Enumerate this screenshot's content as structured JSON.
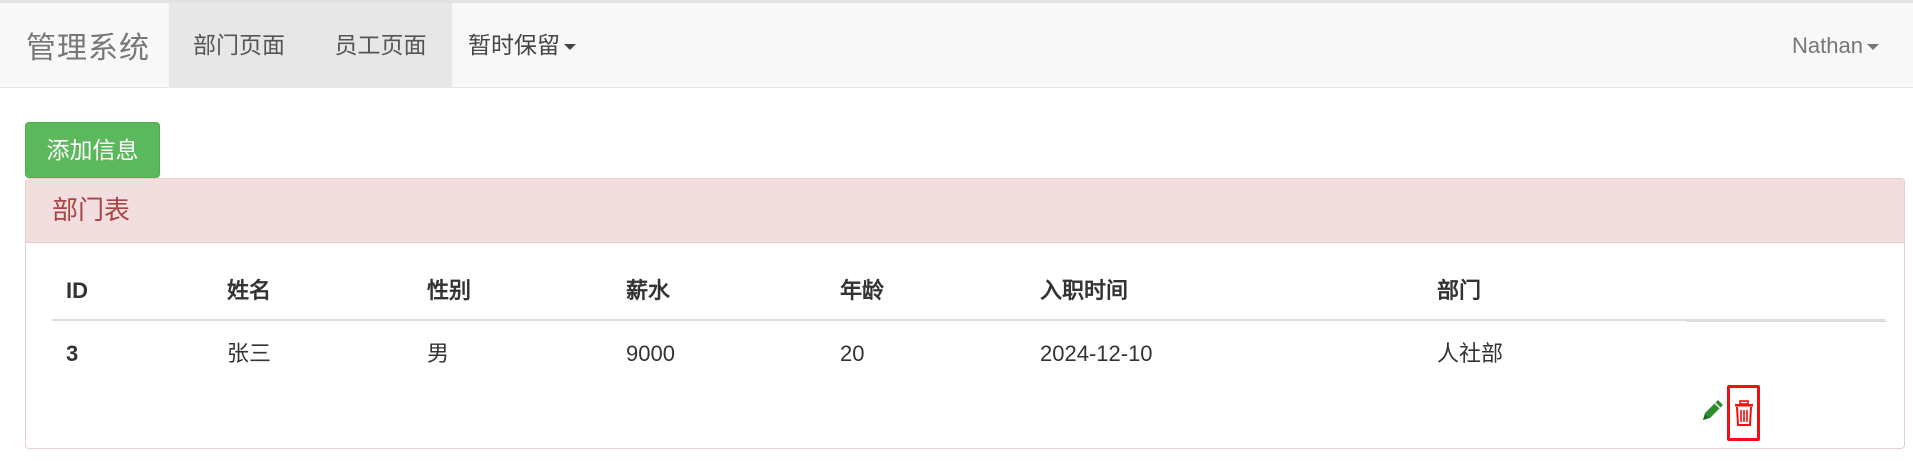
{
  "navbar": {
    "brand": "管理系统",
    "items": [
      {
        "label": "部门页面"
      },
      {
        "label": "员工页面"
      },
      {
        "label": "暂时保留"
      }
    ],
    "user": "Nathan"
  },
  "add_button": "添加信息",
  "panel": {
    "title": "部门表",
    "columns": [
      "ID",
      "姓名",
      "性别",
      "薪水",
      "年龄",
      "入职时间",
      "部门"
    ],
    "rows": [
      {
        "id": "3",
        "name": "张三",
        "gender": "男",
        "salary": "9000",
        "age": "20",
        "hire_date": "2024-12-10",
        "dept": "人社部"
      }
    ]
  },
  "colors": {
    "success": "#5cb85c",
    "danger_heading_bg": "#f2dede",
    "danger_heading_text": "#a94442",
    "edit_icon": "#2e8b2e",
    "delete_icon": "#ee1111"
  },
  "icons": {
    "edit": "pencil-icon",
    "delete": "trash-icon"
  }
}
